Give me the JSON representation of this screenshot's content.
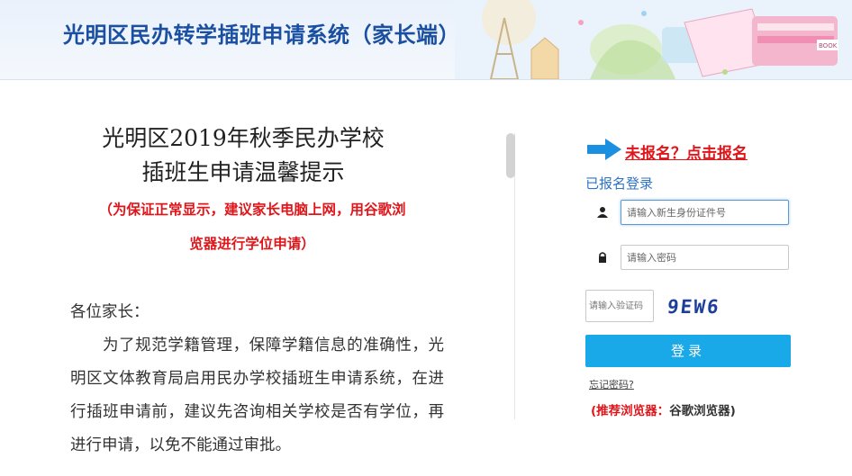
{
  "header": {
    "title": "光明区民办转学插班申请系统（家长端）",
    "sign_text": "BOOK"
  },
  "notice": {
    "title_line1": "光明区2019年秋季民办学校",
    "title_line2": "插班生申请温馨提示",
    "red_line1": "（为保证正常显示，建议家长电脑上网，用谷歌浏",
    "red_line2": "览器进行学位申请）",
    "greeting": "各位家长：",
    "paragraph": "为了规范学籍管理，保障学籍信息的准确性，光明区文体教育局启用民办学校插班生申请系统，在进行插班申请前，建议先咨询相关学校是否有学位，再进行申请，以免不能通过审批。"
  },
  "login": {
    "register_link": "未报名？点击报名",
    "login_label": "已报名登录",
    "id_placeholder": "请输入新生身份证件号",
    "password_placeholder": "请输入密码",
    "captcha_placeholder": "请输入验证码",
    "captcha_code": "9EW6",
    "login_button": "登录",
    "forgot_link": "忘记密码?",
    "browser_tip_prefix": "(推荐浏览器：",
    "browser_tip_name": "谷歌浏览器)",
    "icons": {
      "arrow": "right-arrow-icon",
      "user": "user-icon",
      "lock": "lock-icon"
    }
  },
  "colors": {
    "brand": "#1b4fa1",
    "accent_button": "#1aa9e8",
    "warning_red": "#e0151a",
    "link_blue": "#2d74c9"
  }
}
